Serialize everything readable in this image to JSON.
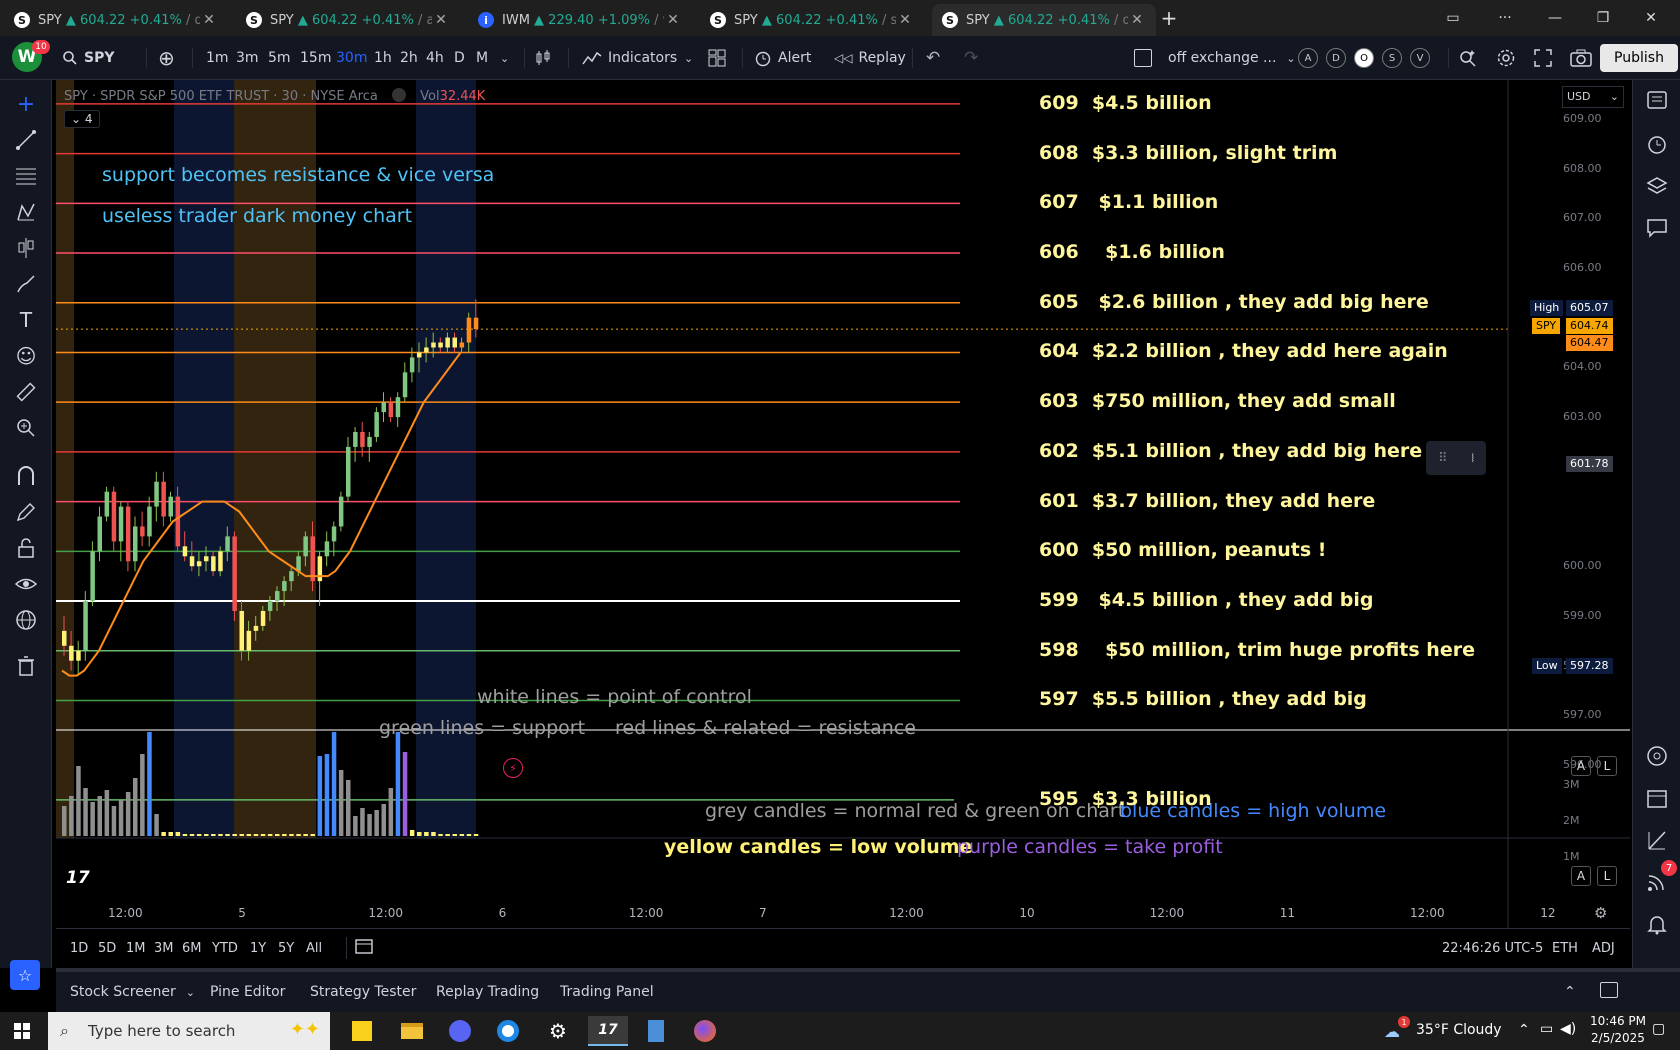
{
  "browser": {
    "tabs": [
      {
        "fav": "S",
        "sym": "SPY",
        "price": "▲ 604.22",
        "chg": "+0.41%",
        "rest": " / da"
      },
      {
        "fav": "S",
        "sym": "SPY",
        "price": "▲ 604.22",
        "chg": "+0.41%",
        "rest": " / ar"
      },
      {
        "fav": "i",
        "sym": "IWM",
        "price": "▲ 229.40",
        "chg": "+1.09%",
        "rest": " / v"
      },
      {
        "fav": "S",
        "sym": "SPY",
        "price": "▲ 604.22",
        "chg": "+0.41%",
        "rest": " / st"
      },
      {
        "fav": "S",
        "sym": "SPY",
        "price": "▲ 604.22",
        "chg": "+0.41%",
        "rest": " / of"
      }
    ],
    "new_tab": "+"
  },
  "toolbar": {
    "avatar": "W",
    "notif_count": "10",
    "symbol": "SPY",
    "intervals": [
      "1m",
      "3m",
      "5m",
      "15m",
      "30m",
      "1h",
      "2h",
      "4h",
      "D",
      "M"
    ],
    "active_interval": "30m",
    "indicators": "Indicators",
    "alert": "Alert",
    "replay": "Replay",
    "session": "off exchange ...",
    "badges": [
      "A",
      "D",
      "O",
      "S",
      "V"
    ],
    "publish": "Publish"
  },
  "chart": {
    "legend_title": "SPY · SPDR S&P 500 ETF TRUST · 30 · NYSE Arca",
    "legend_vol_label": "Vol",
    "legend_vol_value": "32.44K",
    "collapsed_count": "4",
    "currency": "USD",
    "notes": {
      "n1": "support becomes resistance & vice versa",
      "n2": "useless trader dark money chart",
      "n3": "white lines = point of control",
      "n4": "green lines = support",
      "n5": "red lines & related = resistance",
      "n6": "grey candles = normal red & green on chart",
      "n7": "blue candles = high volume",
      "n8": "yellow candles = low volume",
      "n9": "purple candles = take profit"
    },
    "level_labels": [
      "609  $4.5 billion",
      "608  $3.3 billion, slight trim",
      "607   $1.1 billion",
      "606    $1.6 billion",
      "605   $2.6 billion , they add big here",
      "604  $2.2 billion , they add here again",
      "603  $750 million, they add small",
      "602  $5.1 billion , they add big here",
      "601  $3.7 billion, they add here",
      "600  $50 million, peanuts !",
      "599   $4.5 billion , they add big",
      "598    $50 million, trim huge profits here",
      "597  $5.5 billion , they add big",
      "595  $3.3 billion"
    ],
    "price_axis": [
      "609.00",
      "608.00",
      "607.00",
      "606.00",
      "604.00",
      "603.00",
      "600.00",
      "599.00",
      "598.00",
      "597.00",
      "596.00"
    ],
    "tags": {
      "high_label": "High",
      "high_value": "605.07",
      "sym_label": "SPY",
      "sym_value": "604.74",
      "last_value": "604.47",
      "cross_value": "601.78",
      "low_label": "Low",
      "low_value": "597.28"
    },
    "vol_axis": [
      "3M",
      "2M",
      "1M"
    ],
    "time_axis": [
      "12:00",
      "5",
      "12:00",
      "6",
      "12:00",
      "7",
      "12:00",
      "10",
      "12:00",
      "11",
      "12:00",
      "12"
    ],
    "chart_data": {
      "type": "candlestick",
      "title": "SPY · SPDR S&P 500 ETF TRUST · 30 · NYSE Arca",
      "y_range": [
        595.4,
        609.4
      ],
      "levels": [
        {
          "price": 609,
          "color": "#e53935",
          "kind": "resistance"
        },
        {
          "price": 608,
          "color": "#e53935",
          "kind": "resistance"
        },
        {
          "price": 607,
          "color": "#ff4f6a",
          "kind": "resistance"
        },
        {
          "price": 606,
          "color": "#ff4f6a",
          "kind": "resistance"
        },
        {
          "price": 605,
          "color": "#ff8c1a",
          "kind": "resistance"
        },
        {
          "price": 604,
          "color": "#ff8c1a",
          "kind": "resistance"
        },
        {
          "price": 603,
          "color": "#ff8c1a",
          "kind": "resistance"
        },
        {
          "price": 602,
          "color": "#e53935",
          "kind": "resistance"
        },
        {
          "price": 601,
          "color": "#ff4f6a",
          "kind": "resistance"
        },
        {
          "price": 600,
          "color": "#43a047",
          "kind": "support"
        },
        {
          "price": 599,
          "color": "#ffffff",
          "kind": "point of control"
        },
        {
          "price": 598,
          "color": "#66bb6a",
          "kind": "support"
        },
        {
          "price": 597,
          "color": "#43a047",
          "kind": "support"
        },
        {
          "price": 595,
          "color": "#66bb6a",
          "kind": "support"
        }
      ],
      "candles": [
        [
          598.4,
          598.7,
          597.9,
          598.1
        ],
        [
          598.1,
          598.4,
          597.6,
          597.8
        ],
        [
          597.8,
          598.2,
          597.5,
          598.0
        ],
        [
          598.0,
          599.2,
          597.8,
          599.0
        ],
        [
          599.0,
          600.2,
          598.9,
          600.0
        ],
        [
          600.0,
          600.9,
          599.8,
          600.7
        ],
        [
          600.7,
          601.3,
          600.6,
          601.2
        ],
        [
          601.2,
          601.3,
          600.0,
          600.2
        ],
        [
          600.2,
          601.0,
          599.8,
          600.9
        ],
        [
          600.9,
          601.0,
          599.6,
          599.8
        ],
        [
          599.8,
          600.7,
          599.6,
          600.5
        ],
        [
          600.5,
          600.8,
          600.1,
          600.3
        ],
        [
          600.3,
          601.1,
          600.1,
          600.9
        ],
        [
          600.9,
          601.6,
          600.6,
          601.4
        ],
        [
          601.4,
          601.6,
          600.5,
          600.7
        ],
        [
          600.7,
          601.2,
          600.6,
          601.1
        ],
        [
          601.1,
          601.3,
          600.0,
          600.1
        ],
        [
          600.1,
          600.4,
          599.8,
          599.9
        ],
        [
          599.9,
          600.2,
          599.6,
          599.7
        ],
        [
          599.7,
          600.0,
          599.5,
          599.8
        ],
        [
          599.8,
          600.1,
          599.6,
          599.9
        ],
        [
          599.9,
          600.0,
          599.5,
          599.6
        ],
        [
          599.6,
          600.1,
          599.5,
          600.0
        ],
        [
          600.0,
          600.5,
          599.8,
          600.3
        ],
        [
          600.3,
          600.4,
          598.6,
          598.8
        ],
        [
          598.8,
          599.0,
          597.8,
          598.0
        ],
        [
          598.0,
          598.6,
          597.8,
          598.4
        ],
        [
          598.4,
          598.7,
          598.2,
          598.5
        ],
        [
          598.5,
          598.9,
          598.4,
          598.8
        ],
        [
          598.8,
          599.1,
          598.6,
          599.0
        ],
        [
          599.0,
          599.3,
          598.8,
          599.2
        ],
        [
          599.2,
          599.5,
          598.9,
          599.4
        ],
        [
          599.4,
          599.7,
          599.2,
          599.6
        ],
        [
          599.6,
          600.0,
          599.5,
          599.9
        ],
        [
          599.9,
          600.4,
          599.7,
          600.3
        ],
        [
          600.3,
          600.6,
          599.2,
          599.4
        ],
        [
          599.4,
          600.0,
          598.9,
          599.9
        ],
        [
          599.9,
          600.4,
          599.7,
          600.2
        ],
        [
          600.2,
          600.6,
          599.9,
          600.5
        ],
        [
          600.5,
          601.2,
          600.4,
          601.1
        ],
        [
          601.1,
          602.3,
          601.0,
          602.1
        ],
        [
          602.1,
          602.5,
          601.8,
          602.4
        ],
        [
          602.4,
          602.6,
          601.9,
          602.1
        ],
        [
          602.1,
          602.4,
          601.8,
          602.3
        ],
        [
          602.3,
          602.9,
          602.2,
          602.8
        ],
        [
          602.8,
          603.2,
          602.6,
          603.0
        ],
        [
          603.0,
          603.1,
          602.6,
          602.7
        ],
        [
          602.7,
          603.2,
          602.5,
          603.1
        ],
        [
          603.1,
          603.8,
          603.0,
          603.6
        ],
        [
          603.6,
          604.1,
          603.4,
          603.9
        ],
        [
          603.9,
          604.2,
          603.6,
          604.0
        ],
        [
          604.0,
          604.3,
          603.8,
          604.1
        ],
        [
          604.1,
          604.4,
          603.9,
          604.2
        ],
        [
          604.2,
          604.3,
          604.0,
          604.1
        ],
        [
          604.1,
          604.4,
          604.0,
          604.3
        ],
        [
          604.3,
          604.4,
          604.0,
          604.1
        ],
        [
          604.1,
          604.3,
          604.0,
          604.2
        ],
        [
          604.2,
          604.8,
          604.0,
          604.7
        ],
        [
          604.7,
          605.07,
          604.3,
          604.47
        ]
      ],
      "moving_average": [
        597.6,
        597.5,
        597.5,
        597.6,
        597.8,
        598.0,
        598.3,
        598.6,
        598.9,
        599.2,
        599.5,
        599.8,
        600.0,
        600.2,
        600.4,
        600.6,
        600.7,
        600.8,
        600.9,
        601.0,
        601.0,
        601.0,
        601.0,
        600.9,
        600.8,
        600.6,
        600.4,
        600.2,
        600.0,
        599.9,
        599.8,
        599.7,
        599.6,
        599.5,
        599.5,
        599.5,
        599.5,
        599.6,
        599.8,
        600.0,
        600.3,
        600.6,
        600.9,
        601.2,
        601.5,
        601.8,
        602.1,
        602.4,
        602.7,
        603.0,
        603.2,
        603.4,
        603.6,
        603.8,
        604.0
      ],
      "volume_colors_legend": {
        "grey": "normal",
        "blue": "high volume",
        "yellow": "low volume",
        "purple": "take profit"
      }
    }
  },
  "range_bar": {
    "ranges": [
      "1D",
      "5D",
      "1M",
      "3M",
      "6M",
      "YTD",
      "1Y",
      "5Y",
      "All"
    ],
    "clock": "22:46:26 UTC-5",
    "eth": "ETH",
    "adj": "ADJ"
  },
  "bottom_panel": {
    "tabs": [
      "Stock Screener",
      "Pine Editor",
      "Strategy Tester",
      "Replay Trading",
      "Trading Panel"
    ]
  },
  "taskbar": {
    "search_placeholder": "Type here to search",
    "weather": "35°F  Cloudy",
    "weather_badge": "1",
    "time": "10:46 PM",
    "date": "2/5/2025",
    "right_badge": "7"
  }
}
